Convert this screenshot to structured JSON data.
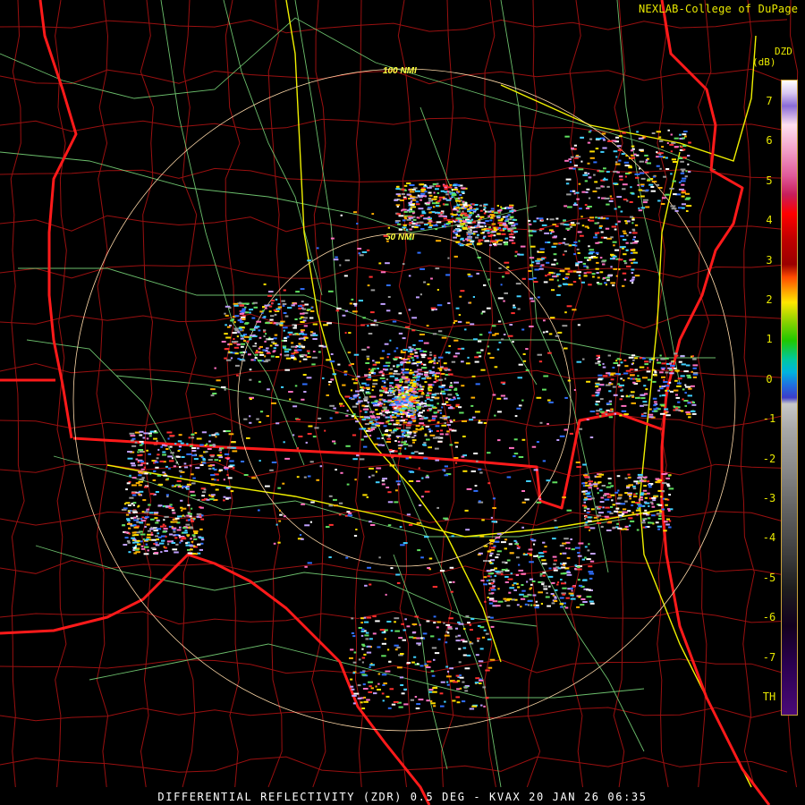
{
  "credit": "NEXLAB-College of DuPage",
  "credit_icon": "small-chart-glyph",
  "legend": {
    "product": "DZD",
    "unit": "(dB)",
    "labels": [
      "7",
      "6",
      "5",
      "4",
      "3",
      "2",
      "1",
      "0",
      "-1",
      "-2",
      "-3",
      "-4",
      "-5",
      "-6",
      "-7",
      "TH"
    ]
  },
  "range_rings": [
    {
      "label": "50 NMI",
      "nmi": 50
    },
    {
      "label": "100 NMI",
      "nmi": 100
    }
  ],
  "footer": {
    "text": "DIFFERENTIAL REFLECTIVITY (ZDR) 0.5 DEG - KVAX 20 JAN 26 06:35"
  },
  "colors": {
    "background": "#000000",
    "county_lines": "#9a1010",
    "state_lines": "#ff1a1a",
    "roads_secondary": "#7fe07f",
    "roads_interstate": "#f0f000",
    "range_rings": "#ffd9a8",
    "text": "#e8e800"
  }
}
